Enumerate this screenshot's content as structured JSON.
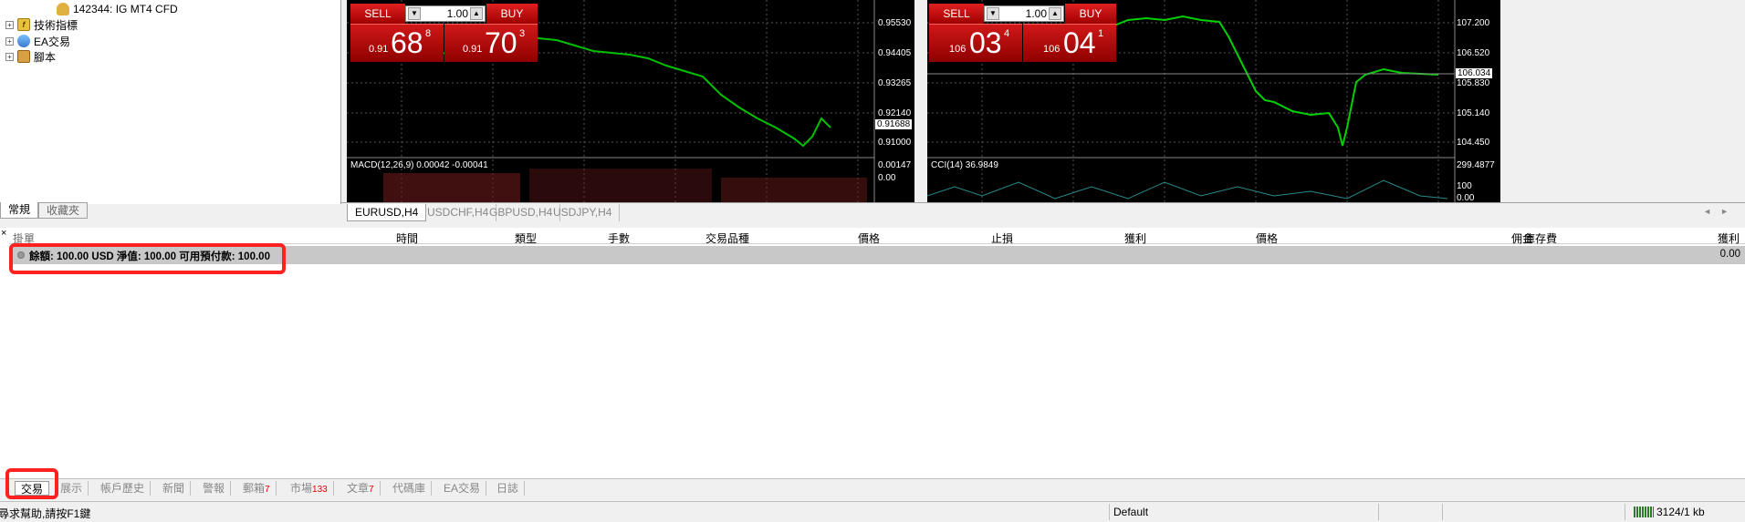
{
  "navigator": {
    "items": [
      {
        "label": "142344: IG MT4 CFD",
        "icon": "account-icon"
      },
      {
        "label": "技術指標",
        "icon": "indicator-icon"
      },
      {
        "label": "EA交易",
        "icon": "expert-advisor-icon"
      },
      {
        "label": "腳本",
        "icon": "script-icon"
      }
    ],
    "tabs": [
      "常規",
      "收藏夾"
    ]
  },
  "charts": [
    {
      "symbol": "EURUSD,H4",
      "sell_label": "SELL",
      "buy_label": "BUY",
      "lot": "1.00",
      "sell_price": {
        "small": "0.91",
        "big": "68",
        "sup": "8"
      },
      "buy_price": {
        "small": "0.91",
        "big": "70",
        "sup": "3"
      },
      "price_axis": [
        "0.95530",
        "0.94405",
        "0.93265",
        "0.92140",
        "0.91000"
      ],
      "current_price": "0.91688",
      "indicator_label": "MACD(12,26,9) 0.00042 -0.00041",
      "indicator_axis": [
        "0.00147",
        "0.00"
      ]
    },
    {
      "symbol": "USDJPY,H4",
      "sell_label": "SELL",
      "buy_label": "BUY",
      "lot": "1.00",
      "sell_price": {
        "small": "106",
        "big": "03",
        "sup": "4"
      },
      "buy_price": {
        "small": "106",
        "big": "04",
        "sup": "1"
      },
      "price_axis": [
        "107.200",
        "106.520",
        "105.830",
        "105.140",
        "104.450"
      ],
      "current_price": "106.034",
      "indicator_label": "CCI(14) 36.9849",
      "indicator_axis": [
        "299.4877",
        "100",
        "0.00"
      ]
    }
  ],
  "chart_tabs": [
    "EURUSD,H4",
    "USDCHF,H4",
    "GBPUSD,H4",
    "USDJPY,H4"
  ],
  "terminal": {
    "columns": [
      "掛單",
      "時間",
      "類型",
      "手數",
      "交易品種",
      "價格",
      "止損",
      "獲利",
      "價格",
      "佣金",
      "庫存費",
      "獲利"
    ],
    "balance_text": "餘額: 100.00 USD  淨值: 100.00  可用預付款: 100.00",
    "balance_value": "0.00",
    "close_glyph": "×"
  },
  "terminal_tabs": [
    {
      "label": "交易",
      "count": ""
    },
    {
      "label": "展示",
      "count": ""
    },
    {
      "label": "帳戶歷史",
      "count": ""
    },
    {
      "label": "新聞",
      "count": ""
    },
    {
      "label": "警報",
      "count": ""
    },
    {
      "label": "郵箱",
      "count": "7"
    },
    {
      "label": "市場",
      "count": "133"
    },
    {
      "label": "文章",
      "count": "7"
    },
    {
      "label": "代碼庫",
      "count": ""
    },
    {
      "label": "EA交易",
      "count": ""
    },
    {
      "label": "日誌",
      "count": ""
    }
  ],
  "status": {
    "help": "尋求幫助,請按F1鍵",
    "profile": "Default",
    "traffic": "3124/1 kb"
  },
  "colors": {
    "highlight": "#ff2020",
    "trade_red": "#c00000",
    "candle_green": "#00c000"
  }
}
